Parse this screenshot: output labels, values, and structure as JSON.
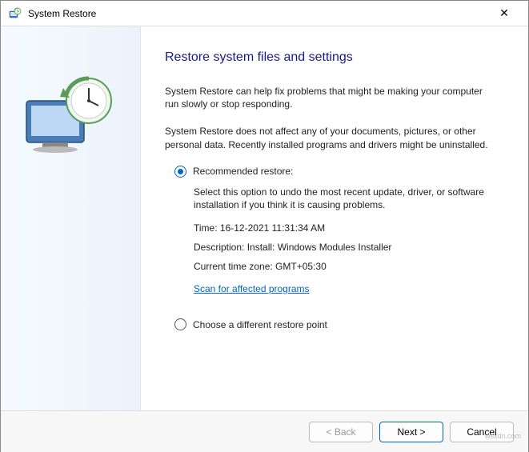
{
  "titlebar": {
    "title": "System Restore",
    "close_label": "✕"
  },
  "main": {
    "heading": "Restore system files and settings",
    "intro1": "System Restore can help fix problems that might be making your computer run slowly or stop responding.",
    "intro2": "System Restore does not affect any of your documents, pictures, or other personal data. Recently installed programs and drivers might be uninstalled.",
    "options": {
      "recommended": {
        "label": "Recommended restore:",
        "desc": "Select this option to undo the most recent update, driver, or software installation if you think it is causing problems.",
        "time_line": "Time: 16-12-2021 11:31:34 AM",
        "desc_line": "Description: Install: Windows Modules Installer",
        "tz_line": "Current time zone: GMT+05:30",
        "scan_link": "Scan for affected programs"
      },
      "different": {
        "label": "Choose a different restore point"
      }
    }
  },
  "footer": {
    "back": "< Back",
    "next": "Next >",
    "cancel": "Cancel"
  },
  "watermark": "wsxdn.com"
}
